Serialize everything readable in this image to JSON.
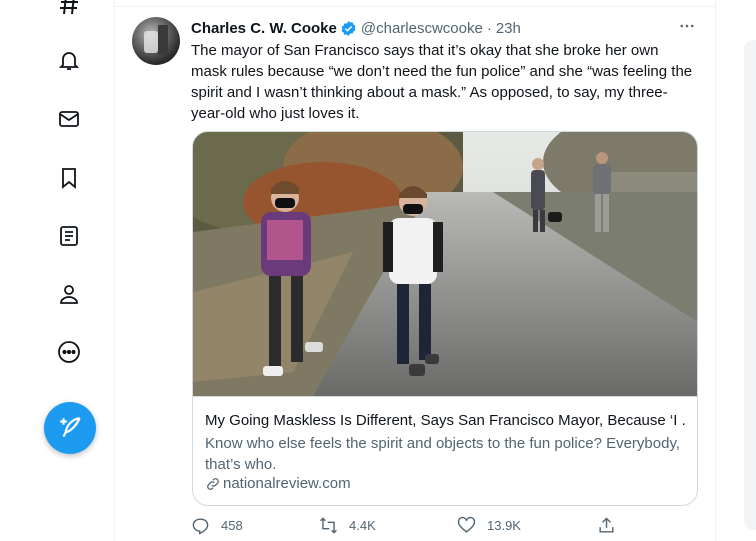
{
  "tweet": {
    "author_name": "Charles C. W. Cooke",
    "author_handle": "@charlescwcooke",
    "separator": "·",
    "timestamp": "23h",
    "text": "The mayor of San Francisco says that it’s okay that she broke her own mask rules because “we don’t need the fun police” and she “was feeling the spirit and I wasn’t thinking about a mask.” As opposed, to say, my three-year-old who just loves it.",
    "card": {
      "title": "My Going Maskless Is Different, Says San Francisco Mayor, Because ‘I ...",
      "description": "Know who else feels the spirit and objects to the fun police? Everybody, that’s who.",
      "domain": "nationalreview.com"
    },
    "actions": {
      "replies": "458",
      "retweets": "4.4K",
      "likes": "13.9K"
    }
  },
  "nav": {
    "icons": [
      "hashtag-icon",
      "bell-icon",
      "mail-icon",
      "bookmark-icon",
      "list-icon",
      "profile-icon",
      "more-circle-icon"
    ],
    "compose_icon": "feather-plus-icon"
  },
  "colors": {
    "accent": "#1d9bf0",
    "text": "#0f1419",
    "secondary": "#536471",
    "border": "#cfd9de"
  }
}
